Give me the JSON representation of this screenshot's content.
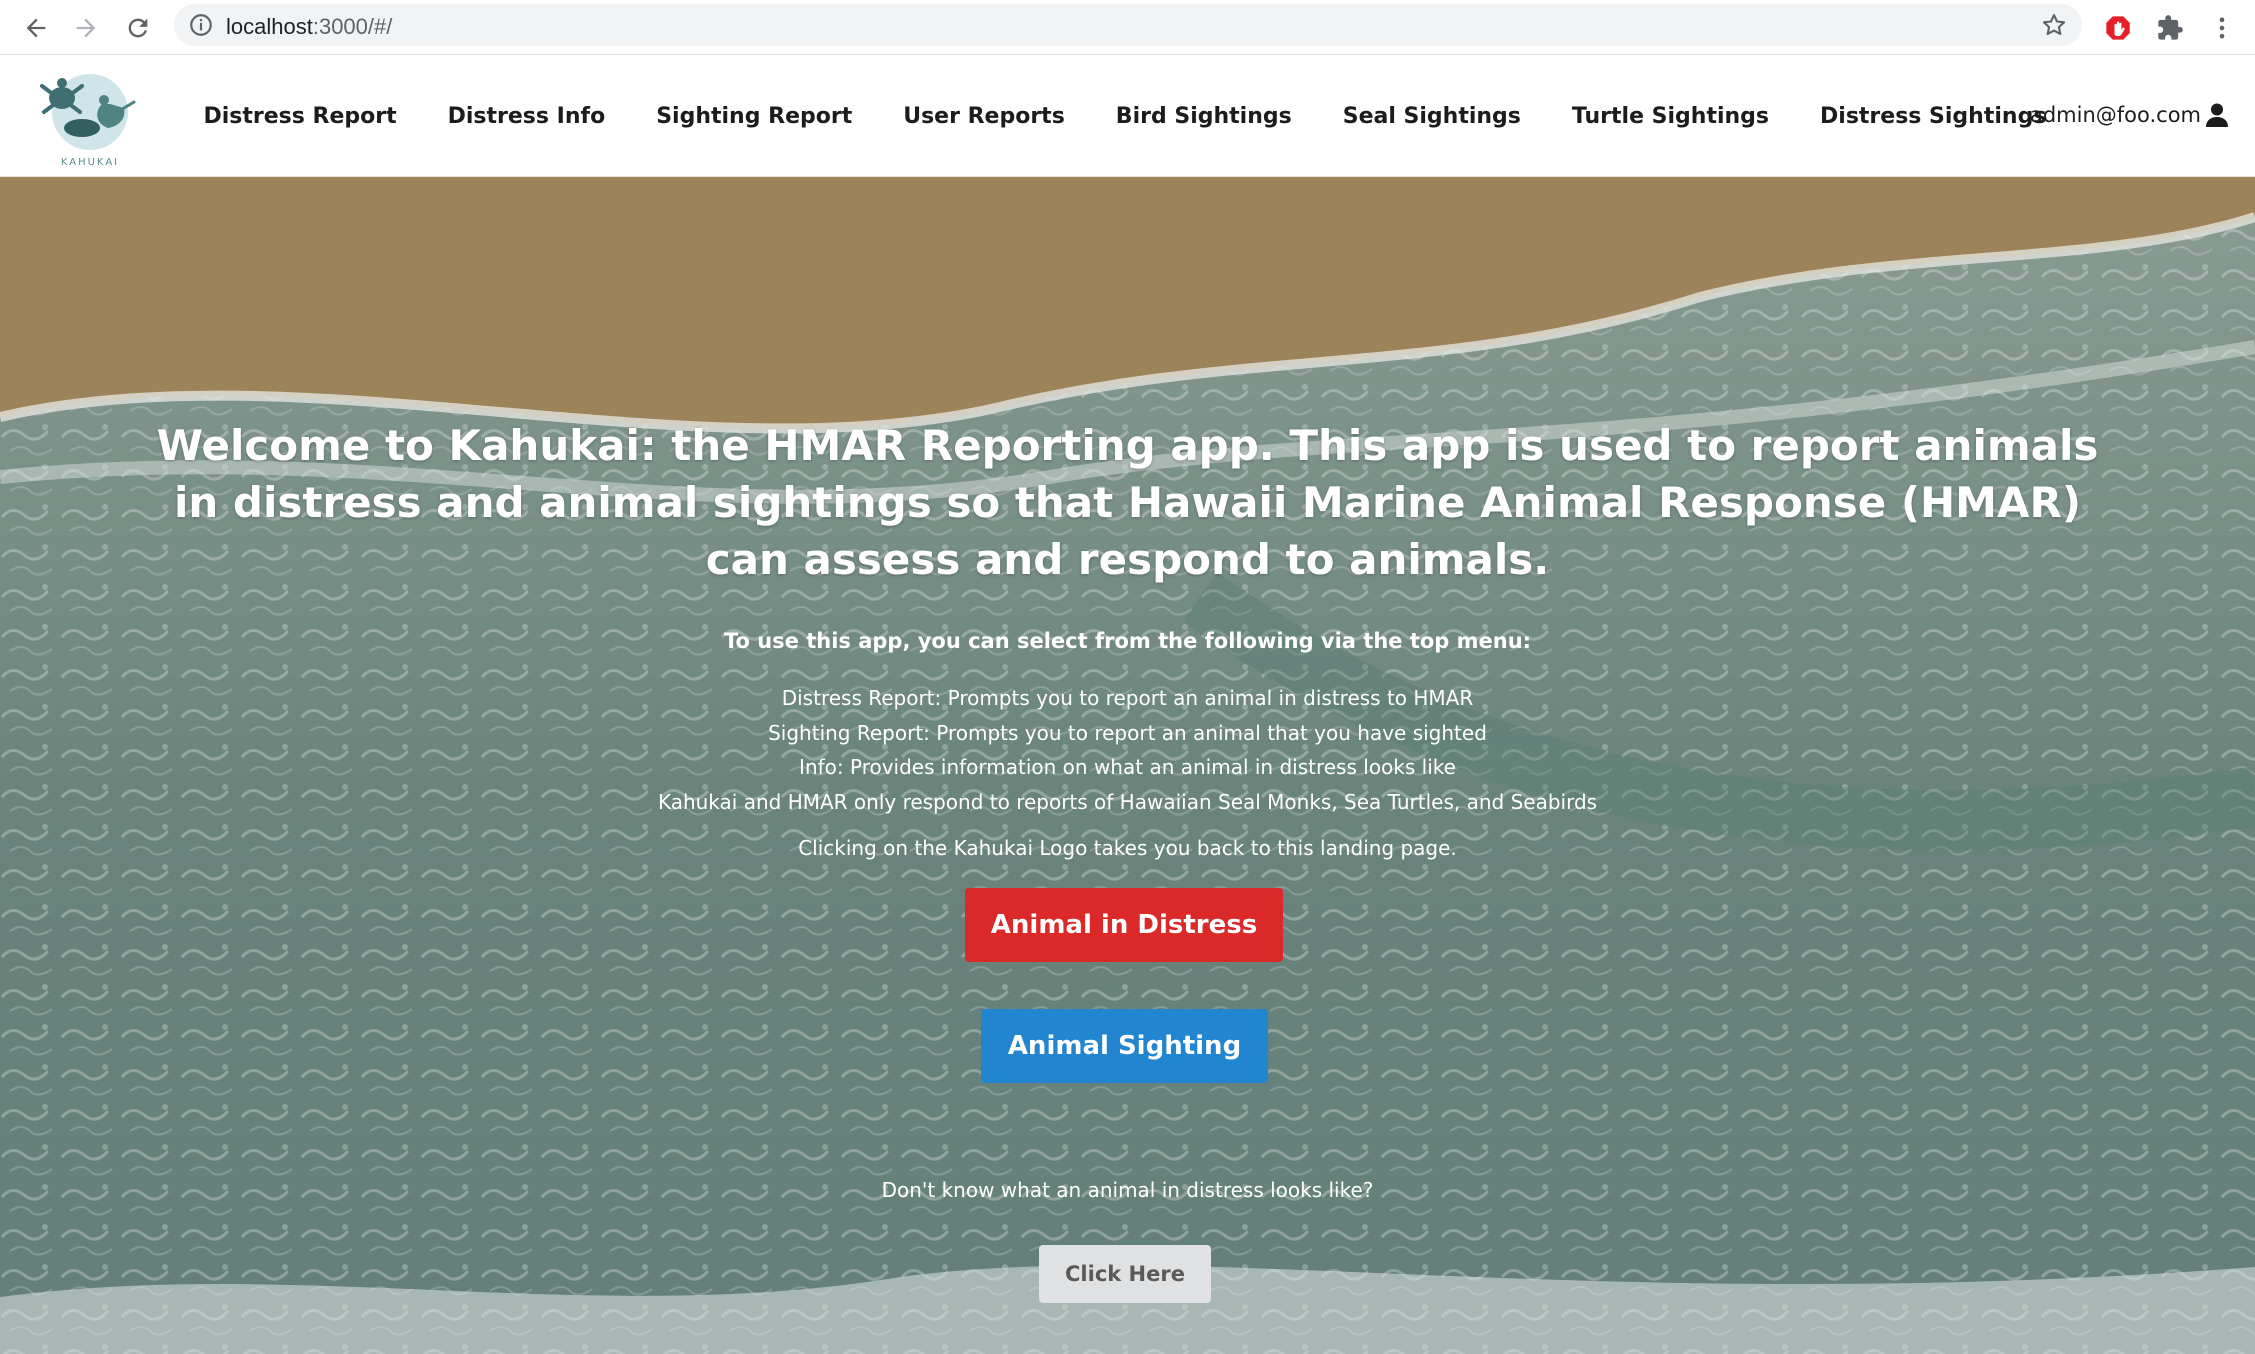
{
  "browser": {
    "url_host": "localhost",
    "url_rest": ":3000/#/"
  },
  "navbar": {
    "logo_text": "KAHUKAI",
    "items": [
      {
        "label": "Distress Report"
      },
      {
        "label": "Distress Info"
      },
      {
        "label": "Sighting Report"
      },
      {
        "label": "User Reports"
      },
      {
        "label": "Bird Sightings"
      },
      {
        "label": "Seal Sightings"
      },
      {
        "label": "Turtle Sightings"
      },
      {
        "label": "Distress Sightings"
      }
    ],
    "user_email": "admin@foo.com"
  },
  "landing": {
    "headline": "Welcome to Kahukai: the HMAR Reporting app. This app is used to report animals in distress and animal sightings so that Hawaii Marine Animal Response (HMAR) can assess and respond to animals.",
    "subhead": "To use this app, you can select from the following via the top menu:",
    "info_lines": [
      "Distress Report: Prompts you to report an animal in distress to HMAR",
      "Sighting Report: Prompts you to report an animal that you have sighted",
      "Info: Provides information on what an animal in distress looks like",
      "Kahukai and HMAR only respond to reports of Hawaiian Seal Monks, Sea Turtles, and Seabirds"
    ],
    "logo_note": "Clicking on the Kahukai Logo takes you back to this landing page.",
    "distress_button": "Animal in Distress",
    "sighting_button": "Animal Sighting",
    "dont_know": "Don't know what an animal in distress looks like?",
    "click_here_button": "Click Here"
  },
  "colors": {
    "distress_red": "#db2828",
    "sighting_blue": "#2185d0",
    "click_grey": "#e0e1e2"
  }
}
